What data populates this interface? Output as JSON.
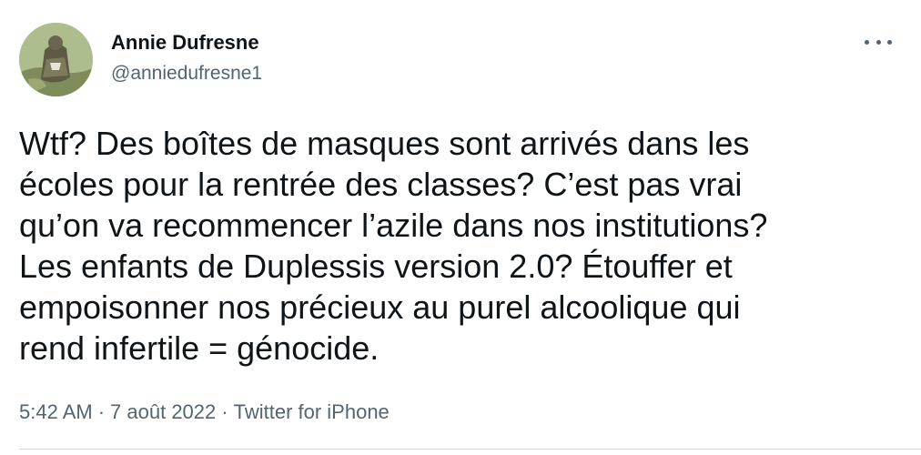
{
  "author": {
    "display_name": "Annie Dufresne",
    "handle": "@anniedufresne1"
  },
  "more_icon": "more-horizontal-icon",
  "tweet_text": "Wtf? Des boîtes de masques sont arrivés dans les\nécoles pour la rentrée des classes? C’est pas vrai\nqu’on va recommencer l’azile dans nos institutions?\nLes enfants de Duplessis version 2.0? Étouffer et\nempoisonner nos précieux au purel alcoolique qui\nrend infertile = génocide.",
  "meta": {
    "time": "5:42 AM",
    "separator": "·",
    "date": "7 août 2022",
    "source": "Twitter for iPhone"
  },
  "colors": {
    "text_primary": "#0f1419",
    "text_secondary": "#536471",
    "divider": "#cfd9de"
  }
}
